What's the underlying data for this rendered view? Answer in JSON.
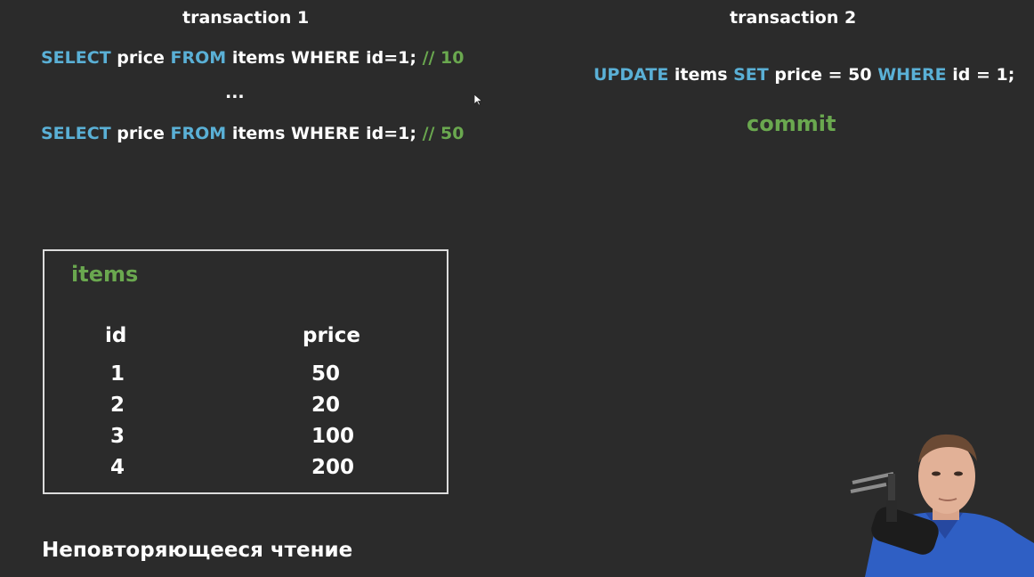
{
  "transaction1": {
    "title": "transaction 1",
    "query1": {
      "kw1": "SELECT",
      "t1": " price ",
      "kw2": "FROM",
      "t2": " items WHERE id=1; ",
      "comment": "// 10"
    },
    "ellipsis": "...",
    "query2": {
      "kw1": "SELECT",
      "t1": " price ",
      "kw2": "FROM",
      "t2": " items WHERE id=1; ",
      "comment": "// 50"
    }
  },
  "transaction2": {
    "title": "transaction 2",
    "update": {
      "kw1": "UPDATE",
      "t1": " items ",
      "kw2": "SET",
      "t2": " price = 50 ",
      "kw3": "WHERE",
      "t3": " id = 1;"
    },
    "commit": "commit"
  },
  "table": {
    "name": "items",
    "headers": [
      "id",
      "price"
    ],
    "rows": [
      [
        "1",
        "50"
      ],
      [
        "2",
        "20"
      ],
      [
        "3",
        "100"
      ],
      [
        "4",
        "200"
      ]
    ]
  },
  "caption": "Неповторяющееся чтение",
  "colors": {
    "keyword": "#5ab0d6",
    "comment": "#6aa84f",
    "background": "#2b2b2b",
    "text": "#ffffff"
  },
  "icons": {
    "cursor": "mouse-pointer-icon",
    "webcam": "presenter-webcam"
  }
}
